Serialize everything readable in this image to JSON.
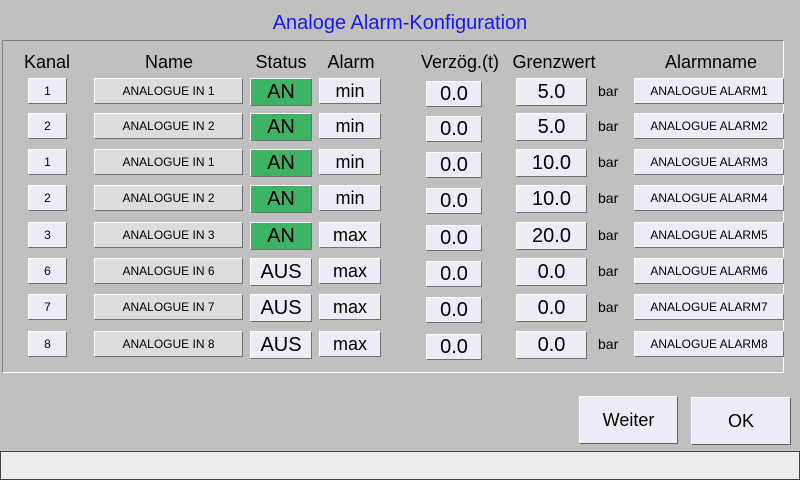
{
  "title": "Analoge Alarm-Konfiguration",
  "headers": {
    "kanal": "Kanal",
    "name": "Name",
    "status": "Status",
    "alarm": "Alarm",
    "verzoeg": "Verzög.(t)",
    "grenzwert": "Grenzwert",
    "alarmname": "Alarmname"
  },
  "colors": {
    "on": "#3cb464",
    "off": "#ececf6",
    "title": "#1a1ae6"
  },
  "rows": [
    {
      "kanal": "1",
      "name": "ANALOGUE  IN 1",
      "status": "AN",
      "status_on": true,
      "alarm": "min",
      "delay": "0.0",
      "limit": "5.0",
      "unit": "bar",
      "alarmname": "ANALOGUE ALARM1"
    },
    {
      "kanal": "2",
      "name": "ANALOGUE IN 2",
      "status": "AN",
      "status_on": true,
      "alarm": "min",
      "delay": "0.0",
      "limit": "5.0",
      "unit": "bar",
      "alarmname": "ANALOGUE ALARM2"
    },
    {
      "kanal": "1",
      "name": "ANALOGUE  IN 1",
      "status": "AN",
      "status_on": true,
      "alarm": "min",
      "delay": "0.0",
      "limit": "10.0",
      "unit": "bar",
      "alarmname": "ANALOGUE ALARM3"
    },
    {
      "kanal": "2",
      "name": "ANALOGUE IN 2",
      "status": "AN",
      "status_on": true,
      "alarm": "min",
      "delay": "0.0",
      "limit": "10.0",
      "unit": "bar",
      "alarmname": "ANALOGUE ALARM4"
    },
    {
      "kanal": "3",
      "name": "ANALOGUE IN 3",
      "status": "AN",
      "status_on": true,
      "alarm": "max",
      "delay": "0.0",
      "limit": "20.0",
      "unit": "bar",
      "alarmname": "ANALOGUE ALARM5"
    },
    {
      "kanal": "6",
      "name": "ANALOGUE IN 6",
      "status": "AUS",
      "status_on": false,
      "alarm": "max",
      "delay": "0.0",
      "limit": "0.0",
      "unit": "bar",
      "alarmname": "ANALOGUE ALARM6"
    },
    {
      "kanal": "7",
      "name": "ANALOGUE IN 7",
      "status": "AUS",
      "status_on": false,
      "alarm": "max",
      "delay": "0.0",
      "limit": "0.0",
      "unit": "bar",
      "alarmname": "ANALOGUE ALARM7"
    },
    {
      "kanal": "8",
      "name": "ANALOGUE IN 8",
      "status": "AUS",
      "status_on": false,
      "alarm": "max",
      "delay": "0.0",
      "limit": "0.0",
      "unit": "bar",
      "alarmname": "ANALOGUE ALARM8"
    }
  ],
  "buttons": {
    "weiter": "Weiter",
    "ok": "OK"
  },
  "statusbar": {
    "text": ""
  }
}
